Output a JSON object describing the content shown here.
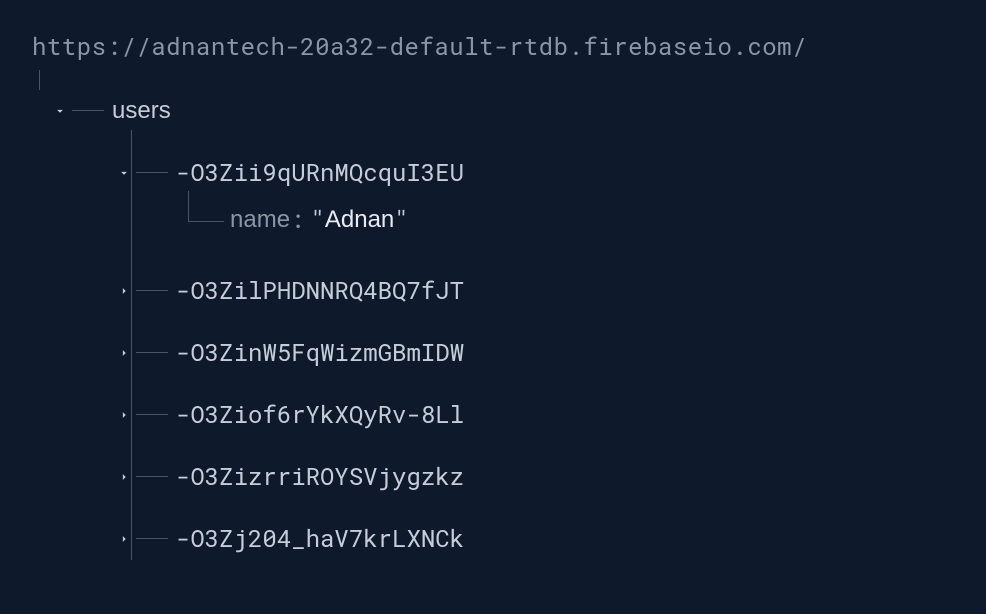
{
  "root_url": "https://adnantech-20a32-default-rtdb.firebaseio.com/",
  "users_label": "users",
  "children": [
    {
      "key": "-O3Zii9qURnMQcquI3EU",
      "expanded": true,
      "fields": {
        "name_label": "name",
        "name_value": "Adnan"
      }
    },
    {
      "key": "-O3ZilPHDNNRQ4BQ7fJT",
      "expanded": false
    },
    {
      "key": "-O3ZinW5FqWizmGBmIDW",
      "expanded": false
    },
    {
      "key": "-O3Ziof6rYkXQyRv-8Ll",
      "expanded": false
    },
    {
      "key": "-O3ZizrriROYSVjygzkz",
      "expanded": false
    },
    {
      "key": "-O3Zj204_haV7krLXNCk",
      "expanded": false
    }
  ]
}
